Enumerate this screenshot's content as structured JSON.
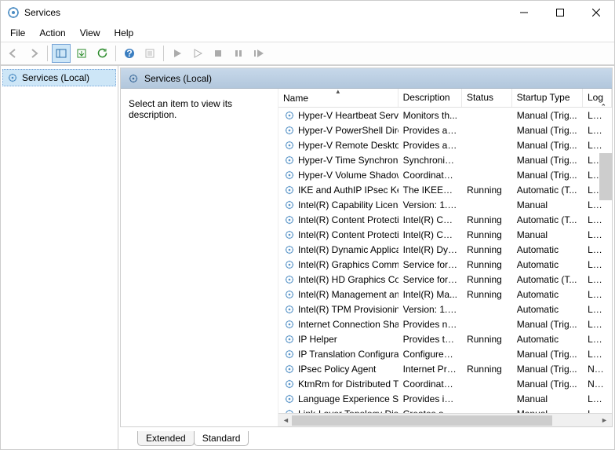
{
  "window": {
    "title": "Services"
  },
  "menu": {
    "file": "File",
    "action": "Action",
    "view": "View",
    "help": "Help"
  },
  "tree": {
    "root": "Services (Local)"
  },
  "pane": {
    "header": "Services (Local)",
    "desc_hint": "Select an item to view its description."
  },
  "columns": {
    "name": "Name",
    "description": "Description",
    "status": "Status",
    "startup": "Startup Type",
    "logon": "Log"
  },
  "tabs": {
    "extended": "Extended",
    "standard": "Standard"
  },
  "services": [
    {
      "name": "Hyper-V Heartbeat Service",
      "desc": "Monitors th...",
      "status": "",
      "startup": "Manual (Trig...",
      "logon": "Loca"
    },
    {
      "name": "Hyper-V PowerShell Direct ...",
      "desc": "Provides a ...",
      "status": "",
      "startup": "Manual (Trig...",
      "logon": "Loca"
    },
    {
      "name": "Hyper-V Remote Desktop Vi...",
      "desc": "Provides a p...",
      "status": "",
      "startup": "Manual (Trig...",
      "logon": "Loca"
    },
    {
      "name": "Hyper-V Time Synchronizati...",
      "desc": "Synchronize...",
      "status": "",
      "startup": "Manual (Trig...",
      "logon": "Loca"
    },
    {
      "name": "Hyper-V Volume Shadow C...",
      "desc": "Coordinates...",
      "status": "",
      "startup": "Manual (Trig...",
      "logon": "Loca"
    },
    {
      "name": "IKE and AuthIP IPsec Keying...",
      "desc": "The IKEEXT ...",
      "status": "Running",
      "startup": "Automatic (T...",
      "logon": "Loca"
    },
    {
      "name": "Intel(R) Capability Licensing...",
      "desc": "Version: 1.6...",
      "status": "",
      "startup": "Manual",
      "logon": "Loca"
    },
    {
      "name": "Intel(R) Content Protection ...",
      "desc": "Intel(R) Con...",
      "status": "Running",
      "startup": "Automatic (T...",
      "logon": "Loca"
    },
    {
      "name": "Intel(R) Content Protection ...",
      "desc": "Intel(R) Con...",
      "status": "Running",
      "startup": "Manual",
      "logon": "Loca"
    },
    {
      "name": "Intel(R) Dynamic Applicatio...",
      "desc": "Intel(R) Dyn...",
      "status": "Running",
      "startup": "Automatic",
      "logon": "Loca"
    },
    {
      "name": "Intel(R) Graphics Command...",
      "desc": "Service for I...",
      "status": "Running",
      "startup": "Automatic",
      "logon": "Loca"
    },
    {
      "name": "Intel(R) HD Graphics Contro...",
      "desc": "Service for I...",
      "status": "Running",
      "startup": "Automatic (T...",
      "logon": "Loca"
    },
    {
      "name": "Intel(R) Management and S...",
      "desc": "Intel(R) Ma...",
      "status": "Running",
      "startup": "Automatic",
      "logon": "Loca"
    },
    {
      "name": "Intel(R) TPM Provisioning S...",
      "desc": "Version: 1.6...",
      "status": "",
      "startup": "Automatic",
      "logon": "Loca"
    },
    {
      "name": "Internet Connection Sharin...",
      "desc": "Provides ne...",
      "status": "",
      "startup": "Manual (Trig...",
      "logon": "Loca"
    },
    {
      "name": "IP Helper",
      "desc": "Provides tu...",
      "status": "Running",
      "startup": "Automatic",
      "logon": "Loca"
    },
    {
      "name": "IP Translation Configuration...",
      "desc": "Configures ...",
      "status": "",
      "startup": "Manual (Trig...",
      "logon": "Loca"
    },
    {
      "name": "IPsec Policy Agent",
      "desc": "Internet Pro...",
      "status": "Running",
      "startup": "Manual (Trig...",
      "logon": "Netw"
    },
    {
      "name": "KtmRm for Distributed Tran...",
      "desc": "Coordinates...",
      "status": "",
      "startup": "Manual (Trig...",
      "logon": "Netw"
    },
    {
      "name": "Language Experience Service",
      "desc": "Provides inf...",
      "status": "",
      "startup": "Manual",
      "logon": "Loca"
    },
    {
      "name": "Link-Layer Topology Discov...",
      "desc": "Creates a N...",
      "status": "",
      "startup": "Manual",
      "logon": "Loca"
    }
  ]
}
